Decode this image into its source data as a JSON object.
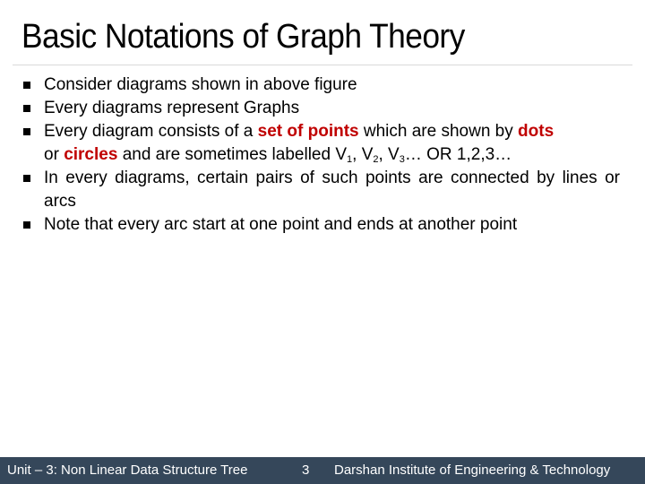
{
  "slide": {
    "title": "Basic Notations of Graph Theory",
    "bullets": [
      {
        "text": "Consider diagrams shown in above figure"
      },
      {
        "text": "Every diagrams represent Graphs"
      },
      {
        "parts": {
          "p1": "Every diagram consists of a ",
          "h1": "set of points",
          "p2": " which are shown by ",
          "h2": "dots",
          "p3": " or ",
          "h3": "circles",
          "p4": " and are sometimes labelled V",
          "s1": "1",
          "p5": ", V",
          "s2": "2",
          "p6": ", V",
          "s3": "3",
          "p7": "… OR 1,2,3…"
        }
      },
      {
        "text": "In every diagrams, certain pairs of such points are connected by lines or arcs"
      },
      {
        "text": "Note that every arc start at one point and ends at another point"
      }
    ],
    "highlight_color": "#c00000"
  },
  "footer": {
    "left": "Unit – 3: Non Linear Data Structure  Tree",
    "page_number": "3",
    "right": "Darshan Institute of Engineering & Technology",
    "background": "#35475a"
  }
}
